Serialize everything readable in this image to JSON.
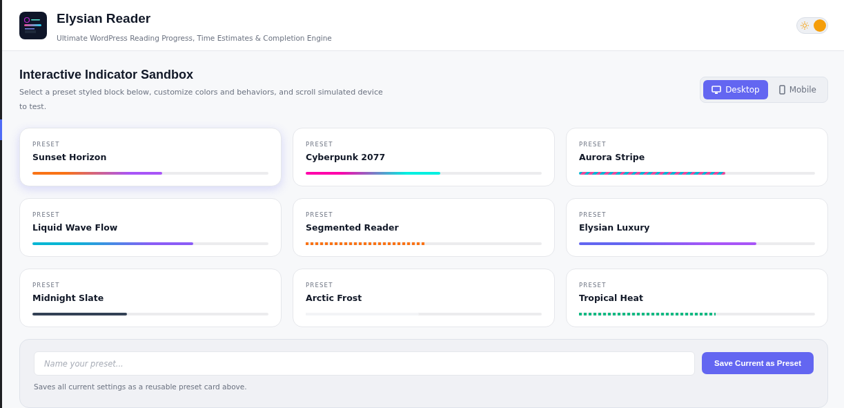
{
  "app": {
    "title": "Elysian Reader",
    "subtitle": "Ultimate WordPress Reading Progress, Time Estimates & Completion Engine",
    "theme_toggle": {
      "on": true
    }
  },
  "sandbox": {
    "title": "Interactive Indicator Sandbox",
    "description": "Select a preset styled block below, customize colors and behaviors, and scroll simulated device to test.",
    "devices": [
      {
        "label": "Desktop",
        "kind": "desktop",
        "selected": true
      },
      {
        "label": "Mobile",
        "kind": "mobile",
        "selected": false
      }
    ]
  },
  "presets": [
    {
      "eyebrow": "PRESET",
      "name": "Sunset Horizon",
      "selected": true,
      "kind": "gradient",
      "level": 0.55,
      "stops": [
        {
          "color": "#f97316"
        },
        {
          "color": "#a855f7"
        }
      ]
    },
    {
      "eyebrow": "PRESET",
      "name": "Cyberpunk 2077",
      "selected": false,
      "kind": "gradient",
      "level": 0.57,
      "stops": [
        {
          "color": "#ff00aa"
        },
        {
          "color": "#00f0e0"
        }
      ]
    },
    {
      "eyebrow": "PRESET",
      "name": "Aurora Stripe",
      "selected": false,
      "kind": "striped",
      "level": 0.62,
      "stops": [
        {
          "color": "#06b6d4"
        },
        {
          "color": "#ec4899"
        }
      ]
    },
    {
      "eyebrow": "PRESET",
      "name": "Liquid Wave Flow",
      "selected": false,
      "kind": "gradient",
      "level": 0.68,
      "stops": [
        {
          "color": "#06b6d4"
        },
        {
          "color": "#8b5cf6"
        }
      ]
    },
    {
      "eyebrow": "PRESET",
      "name": "Segmented Reader",
      "selected": false,
      "kind": "dotted",
      "level": 0.51,
      "stops": [
        {
          "color": "#f97316"
        }
      ]
    },
    {
      "eyebrow": "PRESET",
      "name": "Elysian Luxury",
      "selected": false,
      "kind": "gradient",
      "level": 0.75,
      "stops": [
        {
          "color": "#6366f1"
        },
        {
          "color": "#a855f7"
        }
      ]
    },
    {
      "eyebrow": "PRESET",
      "name": "Midnight Slate",
      "selected": false,
      "kind": "solid",
      "level": 0.4,
      "stops": [
        {
          "color": "#334155"
        }
      ]
    },
    {
      "eyebrow": "PRESET",
      "name": "Arctic Frost",
      "selected": false,
      "kind": "solid",
      "level": 0.48,
      "stops": [
        {
          "color": "#f3f4f6"
        }
      ]
    },
    {
      "eyebrow": "PRESET",
      "name": "Tropical Heat",
      "selected": false,
      "kind": "dotted",
      "level": 0.58,
      "stops": [
        {
          "color": "#10b981"
        }
      ]
    }
  ],
  "save_panel": {
    "placeholder": "Name your preset...",
    "button": "Save Current as Preset",
    "hint": "Saves all current settings as a reusable preset card above."
  }
}
